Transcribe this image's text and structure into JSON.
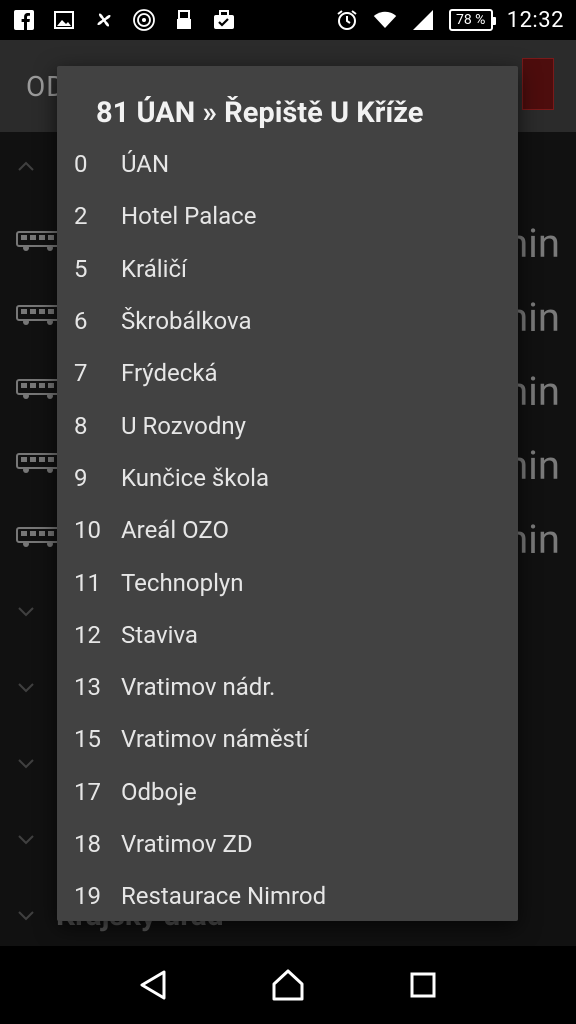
{
  "status_bar": {
    "time": "12:32",
    "battery": "78 %",
    "icons_left": [
      "facebook-icon",
      "gallery-icon",
      "pinwheel-icon",
      "signal-app-icon",
      "usb-icon",
      "briefcase-check-icon"
    ],
    "icons_right": [
      "alarm-icon",
      "wifi-icon",
      "cell-signal-icon",
      "battery-icon"
    ]
  },
  "app_background": {
    "header_text": "OD",
    "min_label": "min",
    "bottom_text": "Krajský úřad"
  },
  "dialog": {
    "title": "81  ÚAN » Řepiště U Kříže",
    "stops": [
      {
        "num": "0",
        "name": "ÚAN"
      },
      {
        "num": "2",
        "name": "Hotel Palace"
      },
      {
        "num": "5",
        "name": "Králičí"
      },
      {
        "num": "6",
        "name": "Škrobálkova"
      },
      {
        "num": "7",
        "name": "Frýdecká"
      },
      {
        "num": "8",
        "name": "U Rozvodny"
      },
      {
        "num": "9",
        "name": "Kunčice škola"
      },
      {
        "num": "10",
        "name": "Areál OZO"
      },
      {
        "num": "11",
        "name": "Technoplyn"
      },
      {
        "num": "12",
        "name": "Staviva"
      },
      {
        "num": "13",
        "name": "Vratimov nádr."
      },
      {
        "num": "15",
        "name": "Vratimov náměstí"
      },
      {
        "num": "17",
        "name": "Odboje"
      },
      {
        "num": "18",
        "name": "Vratimov ZD"
      },
      {
        "num": "19",
        "name": "Restaurace Nimrod"
      }
    ]
  },
  "nav_bar": {
    "buttons": [
      "back-icon",
      "home-icon",
      "recents-icon"
    ]
  }
}
